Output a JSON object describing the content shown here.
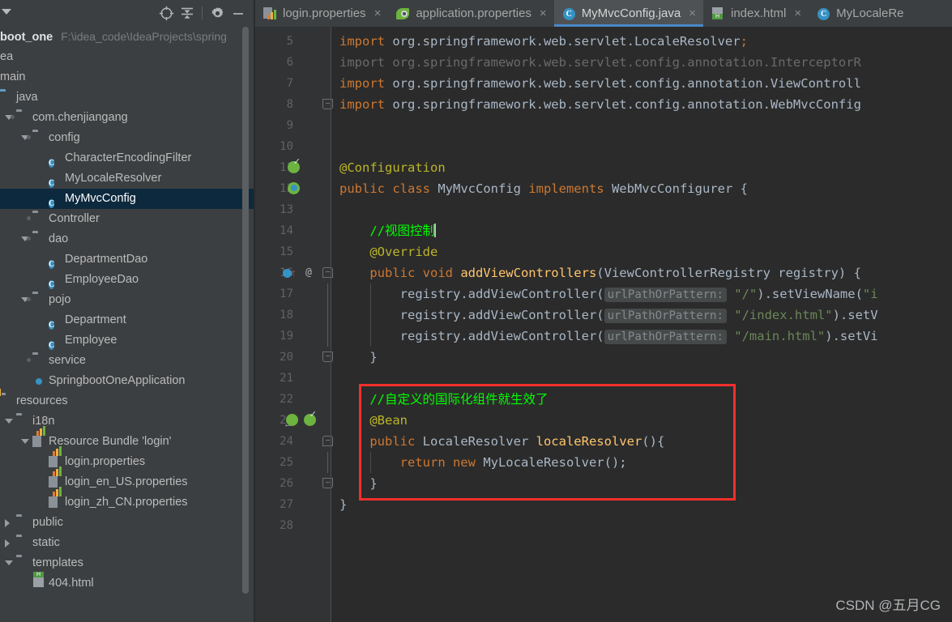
{
  "toolbar": {
    "icons": [
      {
        "name": "select-opened-file-icon",
        "glyph": "⊕"
      },
      {
        "name": "collapse-all-icon",
        "glyph": "≚"
      },
      {
        "name": "settings-gear-icon",
        "glyph": "⚙"
      },
      {
        "name": "hide-panel-icon",
        "glyph": "—"
      }
    ]
  },
  "project_tree": {
    "project_name": "boot_one",
    "project_path": "F:\\idea_code\\IdeaProjects\\spring",
    "items": [
      {
        "label": "ea",
        "indent": 0,
        "icon": "none",
        "arrow": "none",
        "selected": false,
        "kind": "clipped"
      },
      {
        "label": "main",
        "indent": 0,
        "icon": "none",
        "arrow": "none",
        "selected": false,
        "kind": "clipped"
      },
      {
        "label": "java",
        "indent": 0,
        "icon": "source-folder-icon",
        "arrow": "none",
        "selected": false,
        "kind": "folder-src"
      },
      {
        "label": "com.chenjiangang",
        "indent": 1,
        "icon": "package-icon",
        "arrow": "down",
        "selected": false,
        "kind": "package"
      },
      {
        "label": "config",
        "indent": 2,
        "icon": "package-icon",
        "arrow": "down",
        "selected": false,
        "kind": "package"
      },
      {
        "label": "CharacterEncodingFilter",
        "indent": 3,
        "icon": "java-class-icon",
        "arrow": "none",
        "selected": false,
        "kind": "class"
      },
      {
        "label": "MyLocaleResolver",
        "indent": 3,
        "icon": "java-class-icon",
        "arrow": "none",
        "selected": false,
        "kind": "class"
      },
      {
        "label": "MyMvcConfig",
        "indent": 3,
        "icon": "java-class-icon",
        "arrow": "none",
        "selected": true,
        "kind": "class"
      },
      {
        "label": "Controller",
        "indent": 2,
        "icon": "package-icon",
        "arrow": "none",
        "selected": false,
        "kind": "package"
      },
      {
        "label": "dao",
        "indent": 2,
        "icon": "package-icon",
        "arrow": "down",
        "selected": false,
        "kind": "package"
      },
      {
        "label": "DepartmentDao",
        "indent": 3,
        "icon": "java-class-icon",
        "arrow": "none",
        "selected": false,
        "kind": "class"
      },
      {
        "label": "EmployeeDao",
        "indent": 3,
        "icon": "java-class-icon",
        "arrow": "none",
        "selected": false,
        "kind": "class"
      },
      {
        "label": "pojo",
        "indent": 2,
        "icon": "package-icon",
        "arrow": "down",
        "selected": false,
        "kind": "package"
      },
      {
        "label": "Department",
        "indent": 3,
        "icon": "java-class-icon",
        "arrow": "none",
        "selected": false,
        "kind": "class"
      },
      {
        "label": "Employee",
        "indent": 3,
        "icon": "java-class-icon",
        "arrow": "none",
        "selected": false,
        "kind": "class"
      },
      {
        "label": "service",
        "indent": 2,
        "icon": "package-icon",
        "arrow": "none",
        "selected": false,
        "kind": "package"
      },
      {
        "label": "SpringbootOneApplication",
        "indent": 2,
        "icon": "spring-boot-icon",
        "arrow": "none",
        "selected": false,
        "kind": "spring"
      },
      {
        "label": "resources",
        "indent": 0,
        "icon": "resources-folder-icon",
        "arrow": "none",
        "selected": false,
        "kind": "folder-res"
      },
      {
        "label": "i18n",
        "indent": 1,
        "icon": "folder-icon",
        "arrow": "down",
        "selected": false,
        "kind": "folder"
      },
      {
        "label": "Resource Bundle 'login'",
        "indent": 2,
        "icon": "resource-bundle-icon",
        "arrow": "down",
        "selected": false,
        "kind": "bundle"
      },
      {
        "label": "login.properties",
        "indent": 3,
        "icon": "properties-file-icon",
        "arrow": "none",
        "selected": false,
        "kind": "properties"
      },
      {
        "label": "login_en_US.properties",
        "indent": 3,
        "icon": "properties-file-icon",
        "arrow": "none",
        "selected": false,
        "kind": "properties"
      },
      {
        "label": "login_zh_CN.properties",
        "indent": 3,
        "icon": "properties-file-icon",
        "arrow": "none",
        "selected": false,
        "kind": "properties"
      },
      {
        "label": "public",
        "indent": 1,
        "icon": "folder-icon",
        "arrow": "right",
        "selected": false,
        "kind": "folder"
      },
      {
        "label": "static",
        "indent": 1,
        "icon": "folder-icon",
        "arrow": "right",
        "selected": false,
        "kind": "folder"
      },
      {
        "label": "templates",
        "indent": 1,
        "icon": "folder-icon",
        "arrow": "down",
        "selected": false,
        "kind": "folder"
      },
      {
        "label": "404.html",
        "indent": 2,
        "icon": "html-file-icon",
        "arrow": "none",
        "selected": false,
        "kind": "html"
      }
    ]
  },
  "editor_tabs": [
    {
      "label": "login.properties",
      "icon": "properties-file-icon",
      "active": false,
      "close": "×"
    },
    {
      "label": "application.properties",
      "icon": "spring-properties-icon",
      "active": false,
      "close": "×"
    },
    {
      "label": "MyMvcConfig.java",
      "icon": "java-class-icon",
      "active": true,
      "close": "×"
    },
    {
      "label": "index.html",
      "icon": "html-file-icon",
      "active": false,
      "close": "×"
    },
    {
      "label": "MyLocaleRe",
      "icon": "java-class-icon",
      "active": false,
      "close": ""
    }
  ],
  "code": {
    "first_line": 5,
    "lines": [
      {
        "n": 5,
        "segs": [
          {
            "t": "import ",
            "c": "kw"
          },
          {
            "t": "org.springframework.web.servlet.LocaleResolver",
            "c": "typ"
          },
          {
            "t": ";",
            "c": "kw"
          }
        ]
      },
      {
        "n": 6,
        "segs": [
          {
            "t": "import org.springframework.web.servlet.config.annotation.InterceptorR",
            "c": "dim"
          }
        ]
      },
      {
        "n": 7,
        "segs": [
          {
            "t": "import ",
            "c": "kw"
          },
          {
            "t": "org.springframework.web.servlet.config.annotation.ViewControll",
            "c": "typ"
          }
        ]
      },
      {
        "n": 8,
        "segs": [
          {
            "t": "import ",
            "c": "kw"
          },
          {
            "t": "org.springframework.web.servlet.config.annotation.WebMvcConfig",
            "c": "typ"
          }
        ]
      },
      {
        "n": 9,
        "segs": []
      },
      {
        "n": 10,
        "segs": []
      },
      {
        "n": 11,
        "segs": [
          {
            "t": "@Configuration",
            "c": "ann"
          }
        ]
      },
      {
        "n": 12,
        "segs": [
          {
            "t": "public class ",
            "c": "kw"
          },
          {
            "t": "MyMvcConfig ",
            "c": "typ"
          },
          {
            "t": "implements ",
            "c": "kw"
          },
          {
            "t": "WebMvcConfigurer {",
            "c": "typ"
          }
        ]
      },
      {
        "n": 13,
        "segs": []
      },
      {
        "n": 14,
        "segs": [
          {
            "t": "    //视图控制",
            "c": "cmt"
          }
        ]
      },
      {
        "n": 15,
        "segs": [
          {
            "t": "    @Override",
            "c": "ann"
          }
        ]
      },
      {
        "n": 16,
        "segs": [
          {
            "t": "    ",
            "c": "typ"
          },
          {
            "t": "public void ",
            "c": "kw"
          },
          {
            "t": "addViewControllers",
            "c": "mth"
          },
          {
            "t": "(ViewControllerRegistry registry) {",
            "c": "typ"
          }
        ]
      },
      {
        "n": 17,
        "segs": [
          {
            "t": "        registry.addViewController(",
            "c": "typ"
          },
          {
            "t": "urlPathOrPattern:",
            "c": "hint"
          },
          {
            "t": " ",
            "c": "typ"
          },
          {
            "t": "\"/\"",
            "c": "str"
          },
          {
            "t": ").setViewName(",
            "c": "typ"
          },
          {
            "t": "\"i",
            "c": "str"
          }
        ]
      },
      {
        "n": 18,
        "segs": [
          {
            "t": "        registry.addViewController(",
            "c": "typ"
          },
          {
            "t": "urlPathOrPattern:",
            "c": "hint"
          },
          {
            "t": " ",
            "c": "typ"
          },
          {
            "t": "\"/index.html\"",
            "c": "str"
          },
          {
            "t": ").setV",
            "c": "typ"
          }
        ]
      },
      {
        "n": 19,
        "segs": [
          {
            "t": "        registry.addViewController(",
            "c": "typ"
          },
          {
            "t": "urlPathOrPattern:",
            "c": "hint"
          },
          {
            "t": " ",
            "c": "typ"
          },
          {
            "t": "\"/main.html\"",
            "c": "str"
          },
          {
            "t": ").setVi",
            "c": "typ"
          }
        ]
      },
      {
        "n": 20,
        "segs": [
          {
            "t": "    }",
            "c": "typ"
          }
        ]
      },
      {
        "n": 21,
        "segs": []
      },
      {
        "n": 22,
        "segs": [
          {
            "t": "    //自定义的国际化组件就生效了",
            "c": "cmt"
          }
        ]
      },
      {
        "n": 23,
        "segs": [
          {
            "t": "    @Bean",
            "c": "ann"
          }
        ]
      },
      {
        "n": 24,
        "segs": [
          {
            "t": "    ",
            "c": "typ"
          },
          {
            "t": "public ",
            "c": "kw"
          },
          {
            "t": "LocaleResolver ",
            "c": "typ"
          },
          {
            "t": "localeResolver",
            "c": "mth"
          },
          {
            "t": "(){",
            "c": "typ"
          }
        ]
      },
      {
        "n": 25,
        "segs": [
          {
            "t": "        ",
            "c": "typ"
          },
          {
            "t": "return new ",
            "c": "kw"
          },
          {
            "t": "MyLocaleResolver();",
            "c": "typ"
          }
        ]
      },
      {
        "n": 26,
        "segs": [
          {
            "t": "    }",
            "c": "typ"
          }
        ]
      },
      {
        "n": 27,
        "segs": [
          {
            "t": "}",
            "c": "typ"
          }
        ]
      },
      {
        "n": 28,
        "segs": []
      }
    ]
  },
  "annotation": {
    "red_box_label": "highlighted-code-region",
    "color": "#f2302b"
  },
  "watermark": {
    "text": "CSDN @五月CG"
  },
  "colors": {
    "editor_bg": "#2b2b2b",
    "gutter_bg": "#313335",
    "panel_bg": "#3c3f41",
    "selection_bg": "#0d293e",
    "tab_active_bg": "#4e5254",
    "tab_underline": "#4a88c7",
    "accent_blue": "#3592c4",
    "spring_green": "#6db33f"
  }
}
